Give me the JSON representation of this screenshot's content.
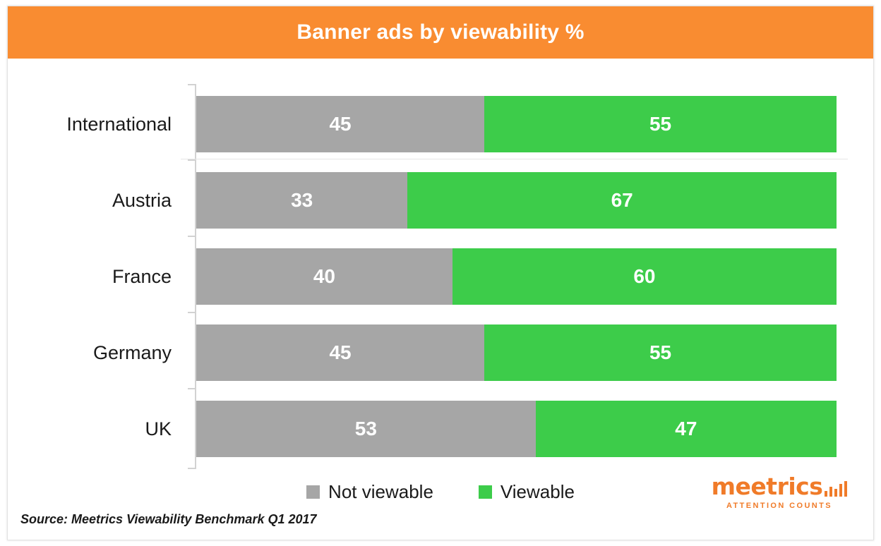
{
  "header": {
    "title": "Banner ads by viewability %",
    "background_color": "#F98C31",
    "text_color": "#FFFFFF"
  },
  "colors": {
    "not_viewable": "#A6A6A6",
    "viewable": "#3DCC4A",
    "accent": "#F98C31",
    "logo": "#F07B29"
  },
  "legend": {
    "items": [
      {
        "label": "Not viewable",
        "color": "#A6A6A6",
        "swatch": "square-swatch"
      },
      {
        "label": "Viewable",
        "color": "#3DCC4A",
        "swatch": "square-swatch"
      }
    ]
  },
  "source_note": "Source: Meetrics Viewability Benchmark Q1 2017",
  "logo": {
    "wordmark": "meetrics",
    "tagline": "ATTENTION COUNTS",
    "bar_heights": [
      8,
      14,
      11,
      18,
      22
    ]
  },
  "chart_data": {
    "type": "bar",
    "orientation": "horizontal",
    "stacked": true,
    "normalized": true,
    "title": "Banner ads by viewability %",
    "subtitle": "",
    "xlabel": "",
    "ylabel": "",
    "xlim": [
      0,
      100
    ],
    "grid": false,
    "legend_position": "bottom-center",
    "categories": [
      "International",
      "Austria",
      "France",
      "Germany",
      "UK"
    ],
    "series": [
      {
        "name": "Not viewable",
        "color": "#A6A6A6",
        "values": [
          45,
          33,
          40,
          45,
          53
        ]
      },
      {
        "name": "Viewable",
        "color": "#3DCC4A",
        "values": [
          55,
          67,
          60,
          55,
          47
        ]
      }
    ],
    "rows": [
      {
        "category": "International",
        "not_viewable": 45,
        "viewable": 55
      },
      {
        "category": "Austria",
        "not_viewable": 33,
        "viewable": 67
      },
      {
        "category": "France",
        "not_viewable": 40,
        "viewable": 60
      },
      {
        "category": "Germany",
        "not_viewable": 45,
        "viewable": 55
      },
      {
        "category": "UK",
        "not_viewable": 53,
        "viewable": 47
      }
    ],
    "annotations": [
      "Source: Meetrics Viewability Benchmark Q1 2017"
    ]
  }
}
